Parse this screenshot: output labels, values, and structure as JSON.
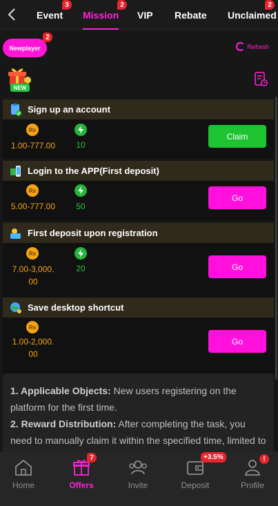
{
  "tabs": [
    {
      "label": "Event",
      "badge": "3"
    },
    {
      "label": "Mission",
      "badge": "2",
      "active": true
    },
    {
      "label": "VIP",
      "badge": ""
    },
    {
      "label": "Rebate",
      "badge": ""
    },
    {
      "label": "Unclaimed",
      "badge": "2"
    }
  ],
  "filter": {
    "label": "Newplayer",
    "badge": "2"
  },
  "refresh_label": "Refresh",
  "coin_symbol": "Rs",
  "tasks": [
    {
      "title": "Sign up an account",
      "amount": "1.00-777.00",
      "energy": "10",
      "action": "Claim"
    },
    {
      "title": "Login to the APP(First deposit)",
      "amount": "5.00-777.00",
      "energy": "50",
      "action": "Go"
    },
    {
      "title": "First deposit upon registration",
      "amount_line1": "7.00-3,000.",
      "amount_line2": "00",
      "energy": "20",
      "action": "Go"
    },
    {
      "title": "Save desktop shortcut",
      "amount_line1": "1.00-2,000.",
      "amount_line2": "00",
      "energy": "",
      "action": "Go"
    }
  ],
  "rules": {
    "item1_label": "1. Applicable Objects:",
    "item1_text": " New users registering on the platform for the first time.",
    "item2_label": "2. Reward Distribution:",
    "item2_text": " After completing the task, you need to manually claim it within the specified time, limited to Android, APPiOS, APP"
  },
  "nav": [
    {
      "label": "Home",
      "badge": ""
    },
    {
      "label": "Offers",
      "badge": "7",
      "active": true
    },
    {
      "label": "Invite",
      "badge": ""
    },
    {
      "label": "Deposit",
      "badge": "+3.5%"
    },
    {
      "label": "Profile",
      "badge": "!"
    }
  ],
  "colors": {
    "accent": "#ff22d8",
    "claim": "#1ec332",
    "coin": "#f3a315",
    "energy": "#27c23f",
    "badge": "#e8242e"
  }
}
